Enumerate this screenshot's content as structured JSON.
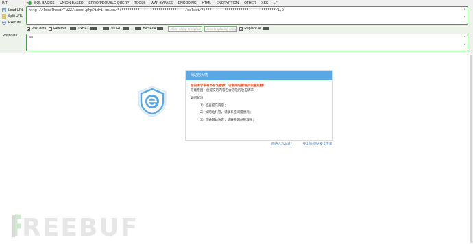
{
  "menubar": {
    "int_label": "INT",
    "items": [
      "SQL BASICS-",
      "UNION BASED-",
      "ERROR/DOUBLE QUERY-",
      "TOOLS-",
      "WAF BYPASS-",
      "ENCODING-",
      "HTML-",
      "ENCRYPTION-",
      "OTHER-",
      "XSS-",
      "LFI-"
    ]
  },
  "hackbar": {
    "load_url": "Load URL",
    "split_url": "Split URL",
    "execute": "Execute",
    "url_value": "http://localhost/FUZZ/index.php?id=1+union/*!*******************************/select/*!**********************************/1,2",
    "post_data_checkbox": "Post data",
    "referrer_checkbox": "Referrer",
    "encodings": [
      "0xHEX",
      "%URL",
      "BASE64"
    ],
    "replace_placeholder": "Insert string to replace",
    "replacing_placeholder": "Insert replacing string",
    "replace_all": "Replace All",
    "post_data_label": "Post data",
    "post_data_value": "aa"
  },
  "waf": {
    "header": "网站防火墙",
    "alert": "您的请求带有不合法参数，已被网站管理员设置拦截！",
    "reason": "可能原因：您提交的内容包含危险的攻击请求",
    "how_to": "如何解决：",
    "steps": [
      "1）检查提交内容；",
      "2）如网站托管，请联系空间提供商；",
      "3）普通网站访客，请联系网站管理员；"
    ],
    "footer_links": [
      "网络人怎么说？",
      "安全狗-网站安全专家"
    ]
  },
  "watermark": {
    "text": "FREEBUF"
  },
  "colors": {
    "hackbar_bg": "#edf3ea",
    "green_border": "#46a046",
    "waf_header": "#5aa7e6",
    "alert": "#e2481c",
    "link": "#3a7ec7"
  }
}
